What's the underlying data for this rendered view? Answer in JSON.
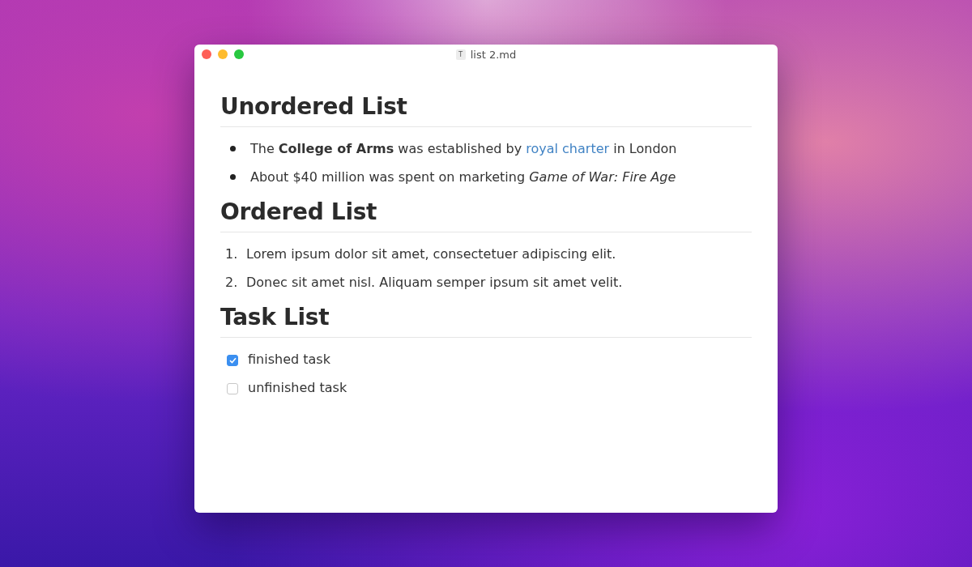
{
  "window": {
    "title": "list 2.md",
    "file_icon": "T"
  },
  "sections": [
    {
      "heading": "Unordered List",
      "kind": "unordered",
      "items": [
        {
          "parts": [
            {
              "kind": "text",
              "text": "The **College of Arms** was established by "
            },
            {
              "kind": "link",
              "text": "royal charter"
            },
            {
              "kind": "text",
              "text": " in London"
            }
          ]
        },
        {
          "parts": [
            {
              "kind": "text",
              "text": "About $40 million was spent on marketing *Game of War: Fire Age*"
            }
          ]
        }
      ]
    },
    {
      "heading": "Ordered List",
      "kind": "ordered",
      "items": [
        {
          "number": "1.",
          "parts": [
            {
              "kind": "text",
              "text": "Lorem ipsum dolor sit amet, consectetuer adipiscing elit."
            }
          ]
        },
        {
          "number": "2.",
          "parts": [
            {
              "kind": "text",
              "text": "Donec sit amet nisl. Aliquam semper ipsum sit amet velit."
            }
          ]
        }
      ]
    },
    {
      "heading": "Task List",
      "kind": "task",
      "items": [
        {
          "checked": true,
          "parts": [
            {
              "kind": "text",
              "text": "finished task"
            }
          ]
        },
        {
          "checked": false,
          "parts": [
            {
              "kind": "text",
              "text": "unfinished task"
            }
          ]
        }
      ]
    }
  ]
}
